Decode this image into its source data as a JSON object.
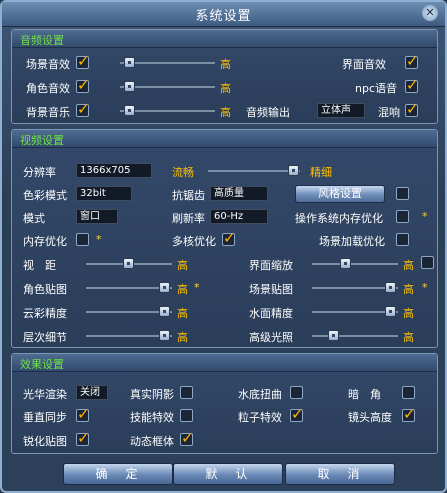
{
  "window": {
    "title": "系统设置"
  },
  "audio": {
    "title": "音频设置",
    "scene_sound": "场景音效",
    "char_sound": "角色音效",
    "bgm": "背景音乐",
    "ui_sound": "界面音效",
    "npc_voice": "npc语音",
    "reverb": "混响",
    "output_label": "音频输出",
    "output_value": "立体声",
    "level_label": "高"
  },
  "video": {
    "title": "视频设置",
    "resolution_label": "分辨率",
    "resolution_value": "1366x705",
    "smooth_label": "流畅",
    "fine_label": "精细",
    "color_mode_label": "色彩模式",
    "color_mode_value": "32bit",
    "aa_label": "抗锯齿",
    "aa_value": "高质量",
    "style_button": "风格设置",
    "mode_label": "模式",
    "mode_value": "窗口",
    "refresh_label": "刷新率",
    "refresh_value": "60-Hz",
    "os_mem_opt": "操作系统内存优化",
    "mem_opt": "内存优化",
    "multicore": "多核优化",
    "scene_load": "场景加载优化",
    "view_distance": "视　距",
    "ui_scale": "界面缩放",
    "char_texture": "角色贴图",
    "scene_texture": "场景贴图",
    "cloud_quality": "云彩精度",
    "water_quality": "水面精度",
    "layer_detail": "层次细节",
    "hdr": "高级光照",
    "level_label": "高",
    "star": "*"
  },
  "effects": {
    "title": "效果设置",
    "bloom_label": "光华渲染",
    "bloom_value": "关闭",
    "real_shadow": "真实阴影",
    "water_distort": "水底扭曲",
    "vignette": "暗　角",
    "vsync": "垂直同步",
    "skill_fx": "技能特效",
    "particle_fx": "粒子特效",
    "camera_height": "镜头高度",
    "sharpen": "锐化贴图",
    "dyn_frame": "动态框体"
  },
  "footer": {
    "ok": "确　定",
    "default": "默　认",
    "cancel": "取　消"
  }
}
